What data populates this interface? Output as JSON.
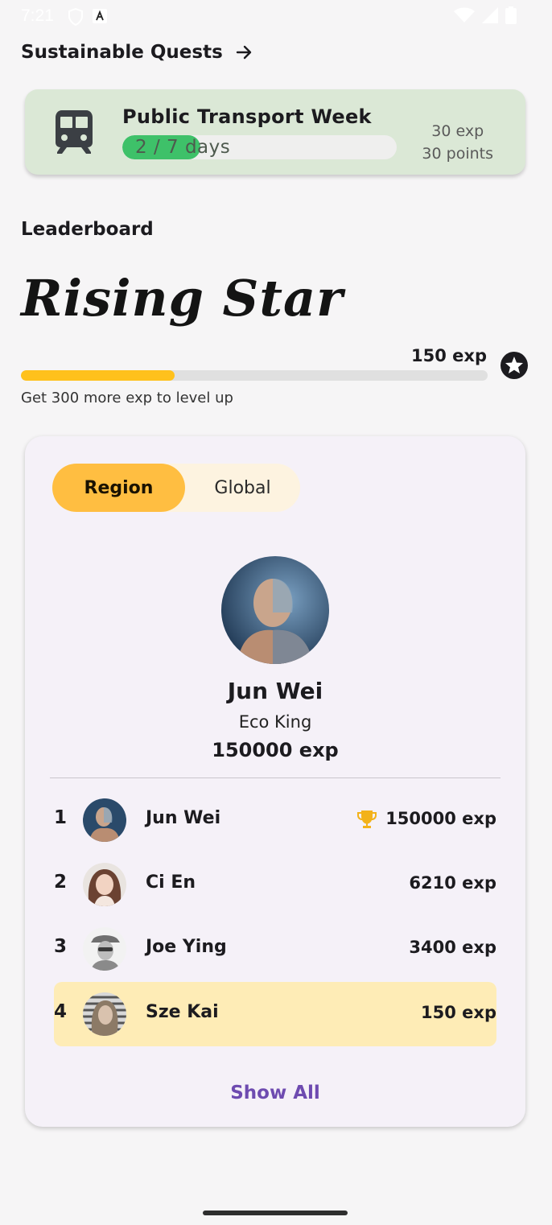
{
  "status_bar": {
    "time": "7:21"
  },
  "quests": {
    "header": "Sustainable Quests",
    "arrow_icon": "arrow-right-icon",
    "card": {
      "icon": "train-icon",
      "title": "Public Transport Week",
      "progress_text": "2 / 7 days",
      "progress_fraction": 0.2857,
      "exp_reward": "30 exp",
      "points_reward": "30 points",
      "background": "#dbe8d6",
      "fill_color": "#3ec169"
    }
  },
  "leaderboard": {
    "header": "Leaderboard",
    "rank_title": "Rising Star",
    "current_exp": "150 exp",
    "level_progress_fraction": 0.33,
    "level_hint": "Get 300 more exp to level up",
    "bar_color": "#ffc11c",
    "tabs": {
      "region": "Region",
      "global": "Global",
      "selected": "Region"
    },
    "top_player": {
      "name": "Jun Wei",
      "title": "Eco King",
      "exp": "150000 exp"
    },
    "rows": [
      {
        "rank": "1",
        "name": "Jun Wei",
        "exp": "150000 exp",
        "trophy": true
      },
      {
        "rank": "2",
        "name": "Ci En",
        "exp": "6210 exp"
      },
      {
        "rank": "3",
        "name": "Joe Ying",
        "exp": "3400 exp"
      },
      {
        "rank": "4",
        "name": "Sze Kai",
        "exp": "150 exp",
        "highlight": true
      }
    ],
    "show_all": "Show All",
    "accent_color": "#ffbe41",
    "link_color": "#6e4bb0"
  }
}
